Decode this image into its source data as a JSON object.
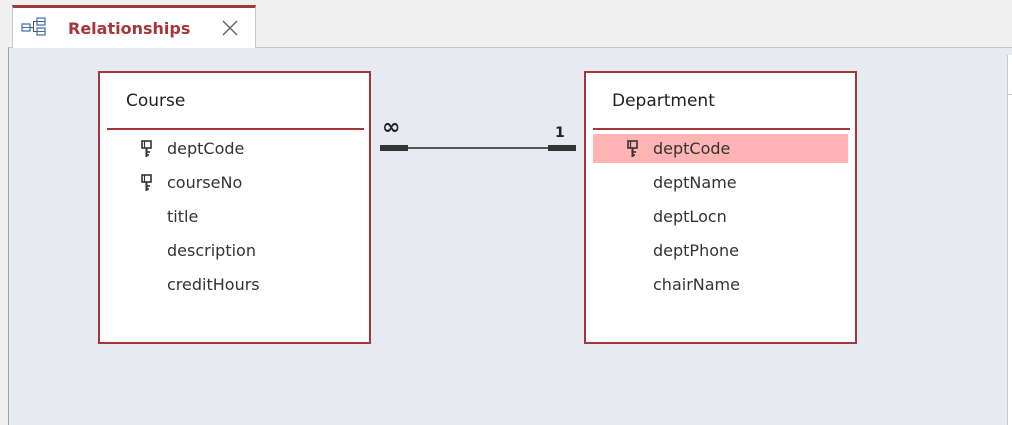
{
  "tab": {
    "label": "Relationships",
    "icon": "relationships-icon",
    "close_icon": "close-icon",
    "accent": "#a4373a"
  },
  "tables": {
    "course": {
      "title": "Course",
      "fields": [
        {
          "name": "deptCode",
          "primary_key": true,
          "selected": false
        },
        {
          "name": "courseNo",
          "primary_key": true,
          "selected": false
        },
        {
          "name": "title",
          "primary_key": false,
          "selected": false
        },
        {
          "name": "description",
          "primary_key": false,
          "selected": false
        },
        {
          "name": "creditHours",
          "primary_key": false,
          "selected": false
        }
      ]
    },
    "department": {
      "title": "Department",
      "fields": [
        {
          "name": "deptCode",
          "primary_key": true,
          "selected": true
        },
        {
          "name": "deptName",
          "primary_key": false,
          "selected": false
        },
        {
          "name": "deptLocn",
          "primary_key": false,
          "selected": false
        },
        {
          "name": "deptPhone",
          "primary_key": false,
          "selected": false
        },
        {
          "name": "chairName",
          "primary_key": false,
          "selected": false
        }
      ]
    }
  },
  "relationship": {
    "many_label": "∞",
    "one_label": "1"
  },
  "colors": {
    "table_border": "#a4373a",
    "selected_row": "#ffb3b3",
    "canvas": "#e7eaf0"
  }
}
